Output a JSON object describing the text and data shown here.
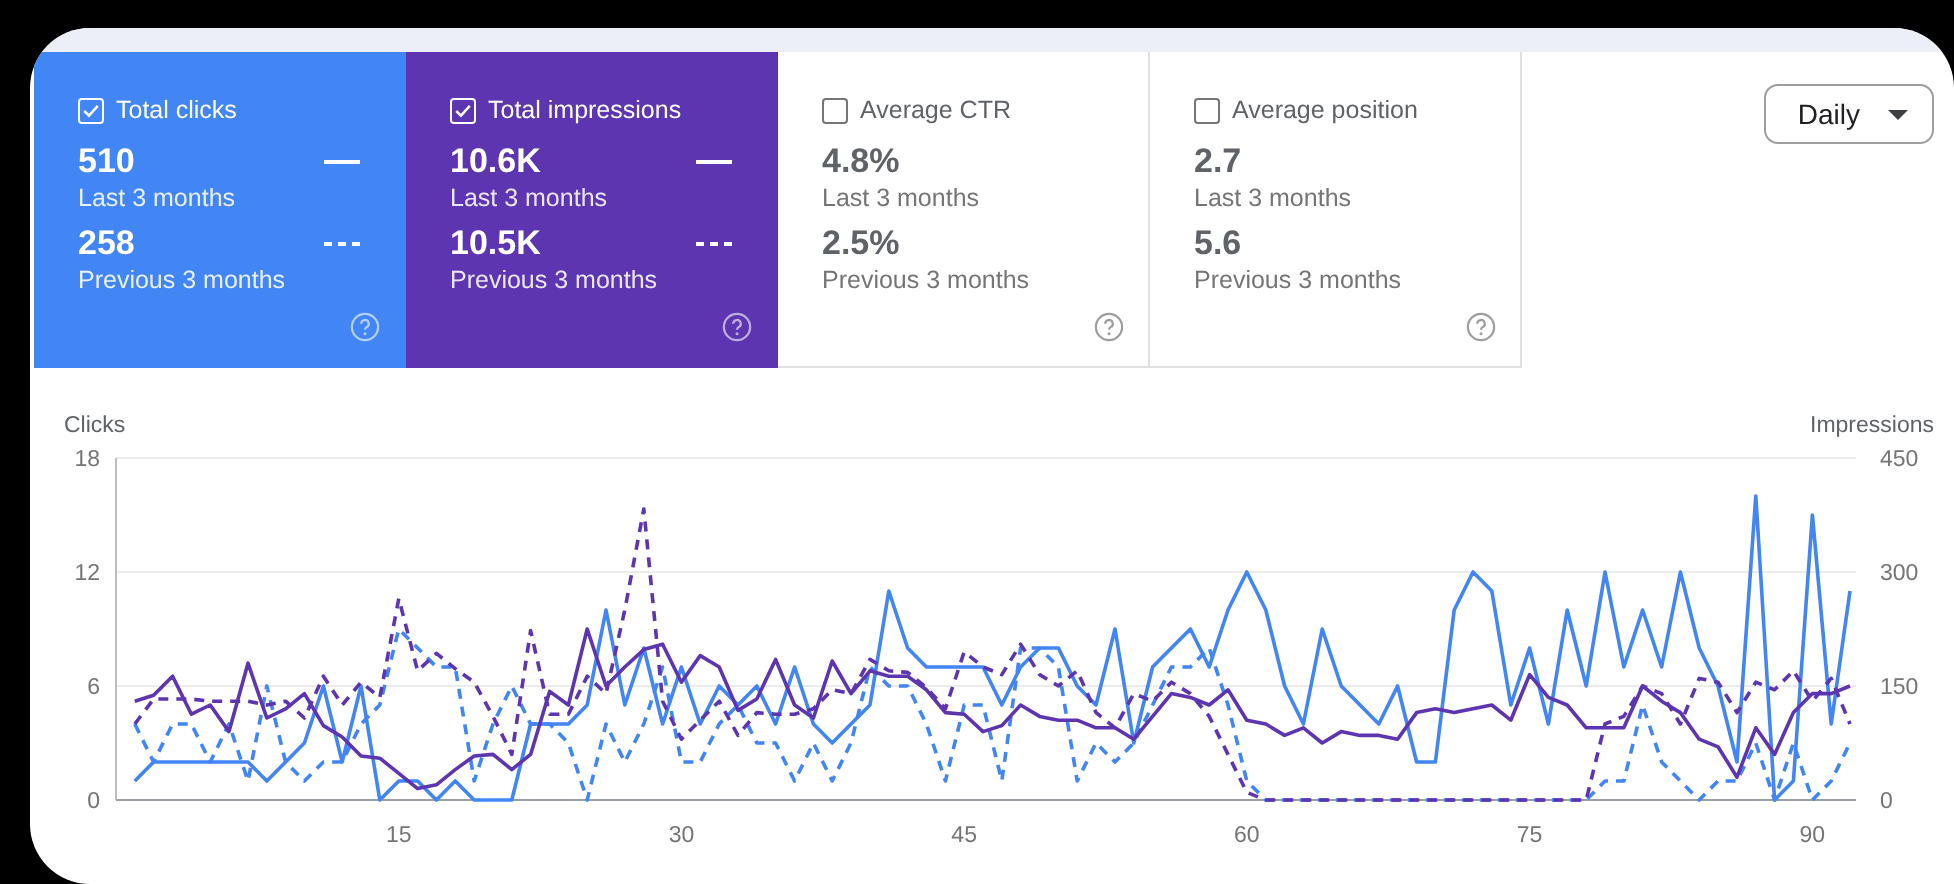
{
  "metric_cards": [
    {
      "label": "Total clicks",
      "checked": true,
      "color": "#4285f4",
      "current_value": "510",
      "current_period": "Last 3 months",
      "previous_value": "258",
      "previous_period": "Previous 3 months"
    },
    {
      "label": "Total impressions",
      "checked": true,
      "color": "#5e35b1",
      "current_value": "10.6K",
      "current_period": "Last 3 months",
      "previous_value": "10.5K",
      "previous_period": "Previous 3 months"
    },
    {
      "label": "Average CTR",
      "checked": false,
      "current_value": "4.8%",
      "current_period": "Last 3 months",
      "previous_value": "2.5%",
      "previous_period": "Previous 3 months"
    },
    {
      "label": "Average position",
      "checked": false,
      "current_value": "2.7",
      "current_period": "Last 3 months",
      "previous_value": "5.6",
      "previous_period": "Previous 3 months"
    }
  ],
  "granularity_dropdown": {
    "value": "Daily"
  },
  "chart": {
    "chart_data": {
      "type": "line",
      "ylabel": "Clicks",
      "y2label": "Impressions",
      "x": [
        1,
        2,
        3,
        4,
        5,
        6,
        7,
        8,
        9,
        10,
        11,
        12,
        13,
        14,
        15,
        16,
        17,
        18,
        19,
        20,
        21,
        22,
        23,
        24,
        25,
        26,
        27,
        28,
        29,
        30,
        31,
        32,
        33,
        34,
        35,
        36,
        37,
        38,
        39,
        40,
        41,
        42,
        43,
        44,
        45,
        46,
        47,
        48,
        49,
        50,
        51,
        52,
        53,
        54,
        55,
        56,
        57,
        58,
        59,
        60,
        61,
        62,
        63,
        64,
        65,
        66,
        67,
        68,
        69,
        70,
        71,
        72,
        73,
        74,
        75,
        76,
        77,
        78,
        79,
        80,
        81,
        82,
        83,
        84,
        85,
        86,
        87,
        88,
        89,
        90,
        91,
        92
      ],
      "xlim": [
        0,
        92
      ],
      "ylim": [
        0,
        18
      ],
      "y2lim": [
        0,
        450
      ],
      "xticks": [
        15,
        30,
        45,
        60,
        75,
        90
      ],
      "yticks": [
        0,
        6,
        12,
        18
      ],
      "y2ticks": [
        0,
        150,
        300,
        450
      ],
      "series": [
        {
          "color": "#4285f4",
          "values": [
            1,
            2,
            2,
            2,
            2,
            2,
            2,
            1,
            2,
            3,
            6,
            2,
            6,
            0,
            1,
            1,
            0,
            1,
            0,
            0,
            0,
            4,
            4,
            4,
            5,
            10,
            5,
            8,
            4,
            7,
            4,
            6,
            5,
            6,
            4,
            7,
            4,
            3,
            4,
            5,
            11,
            8,
            7,
            7,
            7,
            7,
            5,
            7,
            8,
            8,
            6,
            5,
            9,
            3,
            7,
            8,
            9,
            7,
            10,
            12,
            10,
            6,
            4,
            9,
            6,
            5,
            4,
            6,
            2,
            2,
            10,
            12,
            11,
            5,
            8,
            4,
            10,
            6,
            12,
            7,
            10,
            7,
            12,
            8,
            6,
            2,
            16,
            0,
            1,
            15,
            4,
            11
          ]
        },
        {
          "color": "#4285f4",
          "line_style": "dashed",
          "values": [
            4,
            2,
            4,
            4,
            2,
            4,
            1,
            6,
            2,
            1,
            2,
            2,
            4,
            5,
            9,
            8,
            7,
            7,
            1,
            4,
            6,
            4,
            4,
            3,
            0,
            4,
            2,
            4,
            7,
            2,
            2,
            4,
            5,
            3,
            3,
            1,
            3,
            1,
            3,
            7,
            6,
            6,
            4,
            1,
            5,
            5,
            1,
            8,
            8,
            7,
            1,
            3,
            2,
            3,
            5,
            7,
            7,
            8,
            5,
            1,
            0,
            0,
            0,
            0,
            0,
            0,
            0,
            0,
            0,
            0,
            0,
            0,
            0,
            0,
            0,
            0,
            0,
            0,
            1,
            1,
            5,
            2,
            1,
            0,
            1,
            1,
            3,
            0,
            3,
            0,
            1,
            3
          ]
        },
        {
          "color": "#5e35b1",
          "axis": "y2",
          "values": [
            130,
            138,
            163,
            113,
            125,
            90,
            180,
            108,
            120,
            140,
            98,
            83,
            58,
            55,
            35,
            15,
            20,
            40,
            58,
            60,
            40,
            60,
            143,
            125,
            225,
            150,
            175,
            198,
            205,
            155,
            190,
            175,
            118,
            133,
            185,
            125,
            108,
            183,
            140,
            170,
            163,
            163,
            145,
            115,
            113,
            90,
            98,
            125,
            110,
            105,
            105,
            95,
            95,
            80,
            110,
            140,
            135,
            125,
            145,
            105,
            100,
            85,
            95,
            75,
            90,
            85,
            85,
            80,
            115,
            120,
            115,
            120,
            125,
            105,
            165,
            135,
            125,
            95,
            95,
            95,
            150,
            130,
            115,
            80,
            70,
            30,
            95,
            60,
            115,
            140,
            140,
            150
          ]
        },
        {
          "color": "#5e35b1",
          "axis": "y2",
          "line_style": "dashed",
          "values": [
            100,
            133,
            133,
            133,
            130,
            130,
            130,
            125,
            130,
            108,
            163,
            125,
            155,
            135,
            265,
            170,
            193,
            173,
            155,
            110,
            60,
            223,
            113,
            113,
            163,
            140,
            250,
            383,
            130,
            80,
            105,
            130,
            85,
            115,
            113,
            113,
            120,
            145,
            140,
            185,
            170,
            168,
            148,
            120,
            195,
            175,
            165,
            205,
            165,
            150,
            170,
            115,
            95,
            140,
            130,
            155,
            140,
            110,
            60,
            10,
            0,
            0,
            0,
            0,
            0,
            0,
            0,
            0,
            0,
            0,
            0,
            0,
            0,
            0,
            0,
            0,
            0,
            0,
            100,
            110,
            150,
            140,
            100,
            160,
            155,
            115,
            155,
            145,
            170,
            130,
            160,
            100
          ]
        }
      ]
    }
  }
}
